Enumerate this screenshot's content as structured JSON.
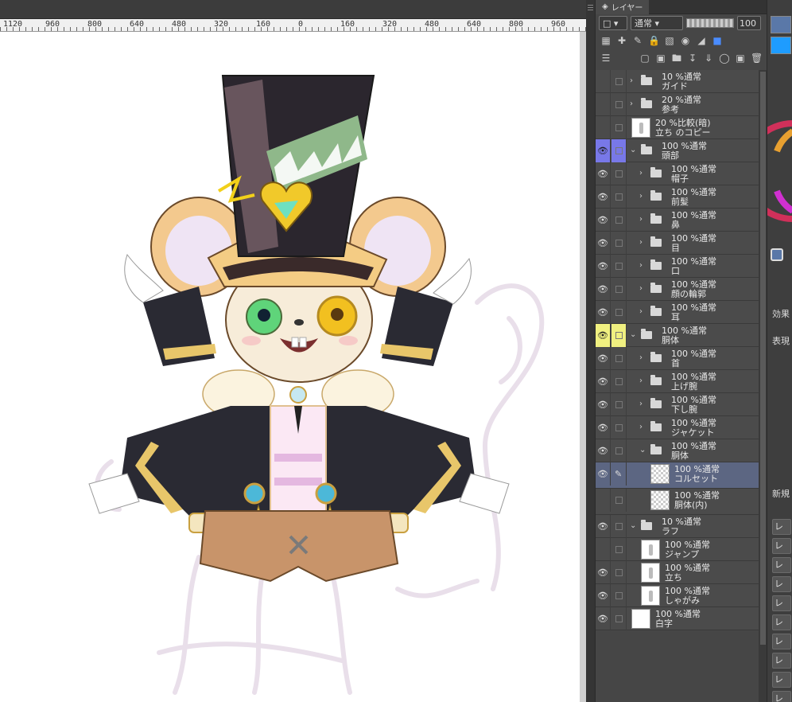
{
  "ruler": {
    "labels": [
      "1120",
      "960",
      "800",
      "640",
      "480",
      "320",
      "160",
      "0",
      "160",
      "320",
      "480",
      "640",
      "800",
      "960"
    ]
  },
  "layer_panel": {
    "tab_label": "レイヤー",
    "blend_mode": "通常",
    "opacity": "100",
    "layers": [
      {
        "mode": "10 %通常",
        "name": "ガイド",
        "type": "folder",
        "visible": false,
        "level": 0,
        "collapsed": true
      },
      {
        "mode": "20 %通常",
        "name": "参考",
        "type": "folder",
        "visible": false,
        "level": 0,
        "collapsed": true
      },
      {
        "mode": "20 %比較(暗)",
        "name": "立ち のコピー",
        "type": "raster",
        "visible": false,
        "level": 0
      },
      {
        "mode": "100 %通常",
        "name": "頭部",
        "type": "folder",
        "visible": true,
        "level": 0,
        "collapsed": false,
        "color": "#7878e8"
      },
      {
        "mode": "100 %通常",
        "name": "帽子",
        "type": "folder",
        "visible": true,
        "level": 1,
        "collapsed": true
      },
      {
        "mode": "100 %通常",
        "name": "前髪",
        "type": "folder",
        "visible": true,
        "level": 1,
        "collapsed": true
      },
      {
        "mode": "100 %通常",
        "name": "鼻",
        "type": "folder",
        "visible": true,
        "level": 1,
        "collapsed": true
      },
      {
        "mode": "100 %通常",
        "name": "目",
        "type": "folder",
        "visible": true,
        "level": 1,
        "collapsed": true
      },
      {
        "mode": "100 %通常",
        "name": "口",
        "type": "folder",
        "visible": true,
        "level": 1,
        "collapsed": true
      },
      {
        "mode": "100 %通常",
        "name": "顔の輪郭",
        "type": "folder",
        "visible": true,
        "level": 1,
        "collapsed": true
      },
      {
        "mode": "100 %通常",
        "name": "耳",
        "type": "folder",
        "visible": true,
        "level": 1,
        "collapsed": true
      },
      {
        "mode": "100 %通常",
        "name": "胴体",
        "type": "folder",
        "visible": true,
        "level": 0,
        "collapsed": false,
        "color": "#f0f080"
      },
      {
        "mode": "100 %通常",
        "name": "首",
        "type": "folder",
        "visible": true,
        "level": 1,
        "collapsed": true
      },
      {
        "mode": "100 %通常",
        "name": "上げ腕",
        "type": "folder",
        "visible": true,
        "level": 1,
        "collapsed": true
      },
      {
        "mode": "100 %通常",
        "name": "下し腕",
        "type": "folder",
        "visible": true,
        "level": 1,
        "collapsed": true
      },
      {
        "mode": "100 %通常",
        "name": "ジャケット",
        "type": "folder",
        "visible": true,
        "level": 1,
        "collapsed": true
      },
      {
        "mode": "100 %通常",
        "name": "胴体",
        "type": "folder",
        "visible": true,
        "level": 1,
        "collapsed": false
      },
      {
        "mode": "100 %通常",
        "name": "コルセット",
        "type": "raster",
        "visible": true,
        "level": 2,
        "selected": true,
        "editing": true
      },
      {
        "mode": "100 %通常",
        "name": "胴体(内)",
        "type": "raster",
        "visible": false,
        "level": 2
      },
      {
        "mode": "10 %通常",
        "name": "ラフ",
        "type": "folder",
        "visible": true,
        "level": 0,
        "collapsed": false
      },
      {
        "mode": "100 %通常",
        "name": "ジャンプ",
        "type": "raster",
        "visible": false,
        "level": 1
      },
      {
        "mode": "100 %通常",
        "name": "立ち",
        "type": "raster",
        "visible": true,
        "level": 1
      },
      {
        "mode": "100 %通常",
        "name": "しゃがみ",
        "type": "raster",
        "visible": true,
        "level": 1
      },
      {
        "mode": "100 %通常",
        "name": "白字",
        "type": "raster",
        "visible": true,
        "level": 0,
        "white": true
      }
    ]
  },
  "side_panel": {
    "label_effect": "効果",
    "label_display": "表現",
    "label_new": "新規",
    "buttons": [
      "レイヤ",
      "レイヤ",
      "レイヤ",
      "レイヤ",
      "レイヤ",
      "レイヤ",
      "レイヤ",
      "レイヤ",
      "レイヤ",
      "レイヤ"
    ],
    "main_color": "#5a78a8",
    "sub_color": "#1e9cff"
  }
}
